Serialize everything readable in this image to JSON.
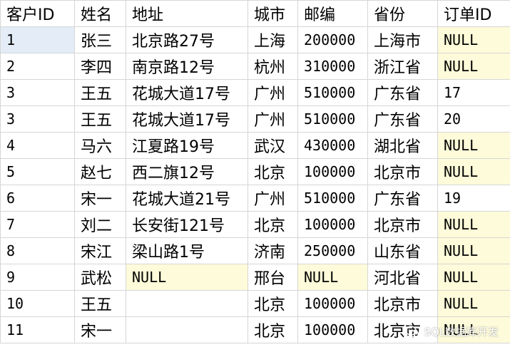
{
  "columns": [
    "客户ID",
    "姓名",
    "地址",
    "城市",
    "邮编",
    "省份",
    "订单ID"
  ],
  "rows": [
    [
      "1",
      "张三",
      "北京路27号",
      "上海",
      "200000",
      "上海市",
      "NULL"
    ],
    [
      "2",
      "李四",
      "南京路12号",
      "杭州",
      "310000",
      "浙江省",
      "NULL"
    ],
    [
      "3",
      "王五",
      "花城大道17号",
      "广州",
      "510000",
      "广东省",
      "17"
    ],
    [
      "3",
      "王五",
      "花城大道17号",
      "广州",
      "510000",
      "广东省",
      "20"
    ],
    [
      "4",
      "马六",
      "江夏路19号",
      "武汉",
      "430000",
      "湖北省",
      "NULL"
    ],
    [
      "5",
      "赵七",
      "西二旗12号",
      "北京",
      "100000",
      "北京市",
      "NULL"
    ],
    [
      "6",
      "宋一",
      "花城大道21号",
      "广州",
      "510000",
      "广东省",
      "19"
    ],
    [
      "7",
      "刘二",
      "长安街121号",
      "北京",
      "100000",
      "北京市",
      "NULL"
    ],
    [
      "8",
      "宋江",
      "梁山路1号",
      "济南",
      "250000",
      "山东省",
      "NULL"
    ],
    [
      "9",
      "武松",
      "NULL",
      "邢台",
      "NULL",
      "河北省",
      "NULL"
    ],
    [
      "10",
      "王五",
      "",
      "北京",
      "100000",
      "北京市",
      "NULL"
    ],
    [
      "11",
      "宋一",
      "",
      "北京",
      "100000",
      "北京市",
      "NULL"
    ]
  ],
  "selected_cell": {
    "row": 0,
    "col": 0
  },
  "watermark": {
    "text": "SQL数据库开发",
    "icon": "wechat-icon"
  },
  "colors": {
    "null_background": "#fdfbd9",
    "selected_background": "#e3ecf7",
    "gridline": "#d6d6d6"
  }
}
